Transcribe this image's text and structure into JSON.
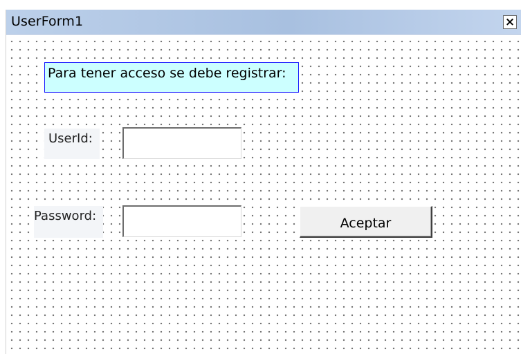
{
  "window": {
    "title": "UserForm1",
    "close_label": "×",
    "close_icon": "close-icon"
  },
  "notice": {
    "text": "Para tener acceso se debe registrar:"
  },
  "fields": {
    "userid_label": "UserId:",
    "userid_value": "",
    "password_label": "Password:",
    "password_value": ""
  },
  "buttons": {
    "accept_label": "Aceptar"
  },
  "colors": {
    "notice_background": "#ccffff",
    "notice_border": "#1a1aff",
    "titlebar": "#a8c0e0"
  }
}
